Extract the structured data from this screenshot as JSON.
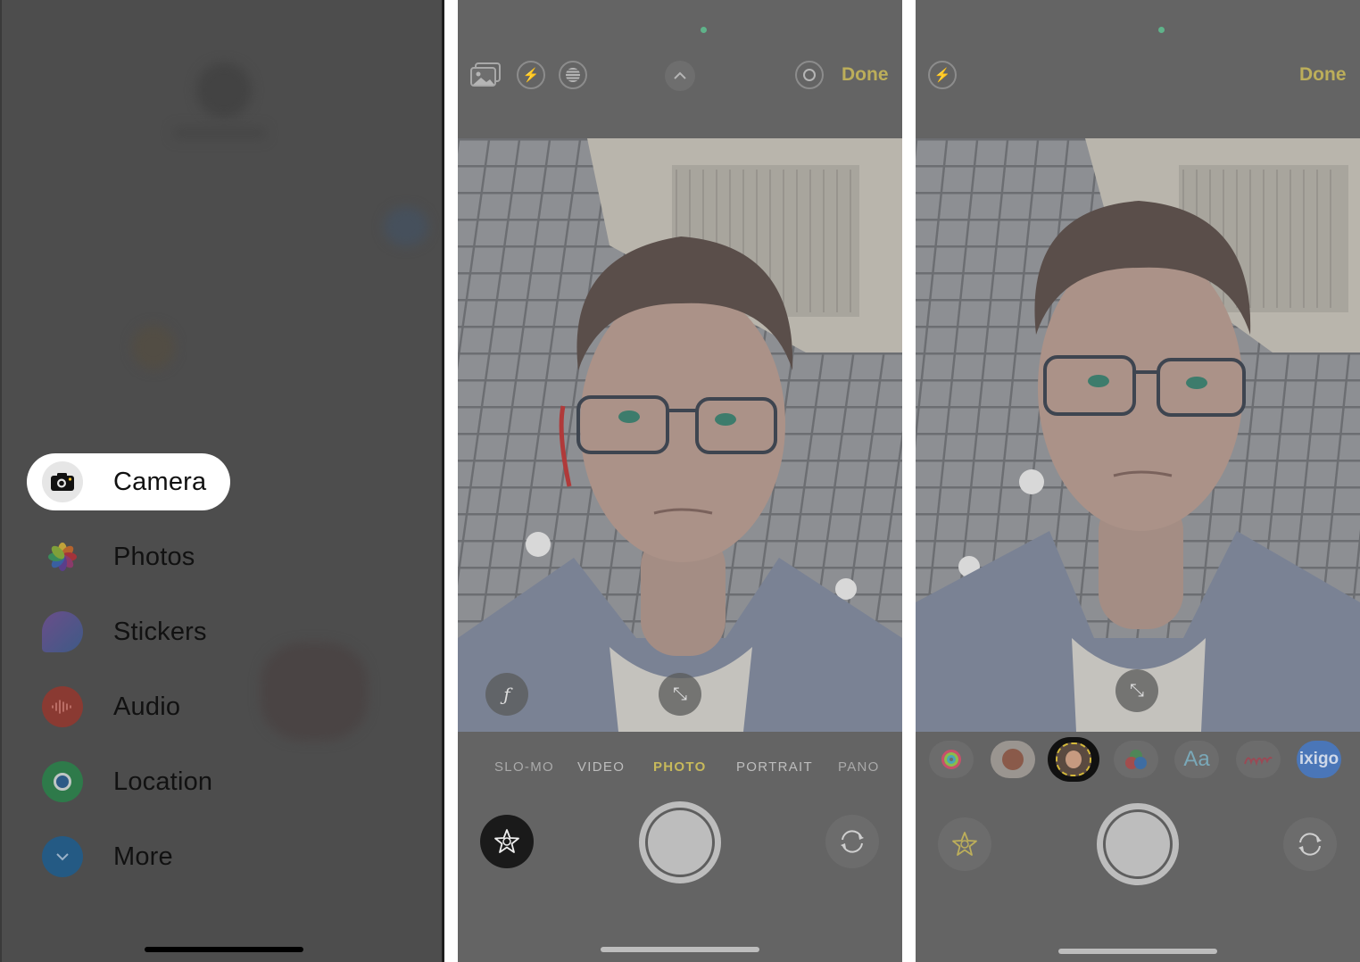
{
  "panel1": {
    "menu": [
      {
        "label": "Camera",
        "icon": "camera-icon",
        "active": true
      },
      {
        "label": "Photos",
        "icon": "photos-icon"
      },
      {
        "label": "Stickers",
        "icon": "stickers-icon"
      },
      {
        "label": "Audio",
        "icon": "audio-waveform-icon"
      },
      {
        "label": "Location",
        "icon": "location-icon"
      },
      {
        "label": "More",
        "icon": "chevron-down-icon"
      }
    ]
  },
  "panel2": {
    "toolbar": {
      "icons": [
        "photo-library-icon",
        "flash-icon",
        "live-photo-icon",
        "chevron-up-icon",
        "live-off-icon"
      ],
      "done_label": "Done"
    },
    "viewfinder_overlays": {
      "filter_icon": "ƒ",
      "expand_icon": "⤡"
    },
    "modes": [
      "SLO-MO",
      "VIDEO",
      "PHOTO",
      "PORTRAIT",
      "PANO"
    ],
    "selected_mode": "PHOTO",
    "effects_button": "effects-star-icon",
    "flip_button": "flip-camera-icon"
  },
  "panel3": {
    "toolbar": {
      "icons": [
        "flash-icon"
      ],
      "done_label": "Done"
    },
    "viewfinder_overlays": {
      "expand_icon": "⤡"
    },
    "effects_tray": [
      {
        "name": "activity-rings",
        "label": ""
      },
      {
        "name": "memoji-stickers",
        "label": ""
      },
      {
        "name": "memoji",
        "label": "",
        "selected": true
      },
      {
        "name": "filters",
        "label": ""
      },
      {
        "name": "text",
        "label": "Aa"
      },
      {
        "name": "shapes",
        "label": ""
      },
      {
        "name": "ixigo",
        "label": "ixigo"
      }
    ],
    "effects_button": "effects-star-icon-active",
    "flip_button": "flip-camera-icon"
  },
  "colors": {
    "accent_yellow": "#c7b95b",
    "done_yellow": "#bcae5a",
    "status_green": "#5fb38a"
  }
}
